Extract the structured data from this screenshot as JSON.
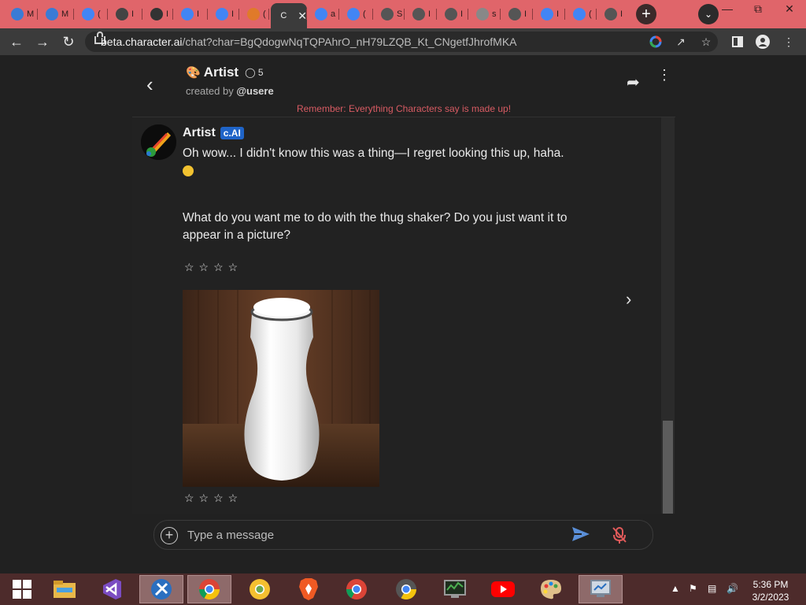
{
  "browser": {
    "tabs": [
      {
        "label": "M",
        "active": false
      },
      {
        "label": "M",
        "active": false
      },
      {
        "label": "(",
        "active": false
      },
      {
        "label": "I",
        "active": false
      },
      {
        "label": "I",
        "active": false
      },
      {
        "label": "I",
        "active": false
      },
      {
        "label": "I",
        "active": false
      },
      {
        "label": "(",
        "active": false
      },
      {
        "label": "C",
        "active": true
      },
      {
        "label": "a",
        "active": false
      },
      {
        "label": "(",
        "active": false
      },
      {
        "label": "S",
        "active": false
      },
      {
        "label": "I",
        "active": false
      },
      {
        "label": "I",
        "active": false
      },
      {
        "label": "s",
        "active": false
      },
      {
        "label": "I",
        "active": false
      },
      {
        "label": "I",
        "active": false
      },
      {
        "label": "(",
        "active": false
      },
      {
        "label": "I",
        "active": false
      }
    ],
    "url_host": "beta.character.ai",
    "url_path": "/chat?char=BgQdogwNqTQPAhrO_nH79LZQB_Kt_CNgetfJhrofMKA"
  },
  "chat": {
    "character_name": "Artist",
    "chat_count": "5",
    "created_by_prefix": "created by",
    "created_by_user": "@usere",
    "reminder": "Remember: Everything Characters say is made up!",
    "message": {
      "author": "Artist",
      "badge": "c.AI",
      "text_line1": "Oh wow... I didn't know this was a thing—I regret looking this up, haha.",
      "text_line2": "What do you want me to do with the thug shaker? Do you just want it to appear in a picture?",
      "rating_stars": "☆☆☆☆"
    },
    "input_placeholder": "Type a message"
  },
  "taskbar": {
    "time": "5:36 PM",
    "date": "3/2/2023"
  },
  "colors": {
    "tabstrip": "#e0656a",
    "reminder": "#d85b63",
    "badge": "#1f64c8",
    "taskbar": "#4d2b2b"
  }
}
